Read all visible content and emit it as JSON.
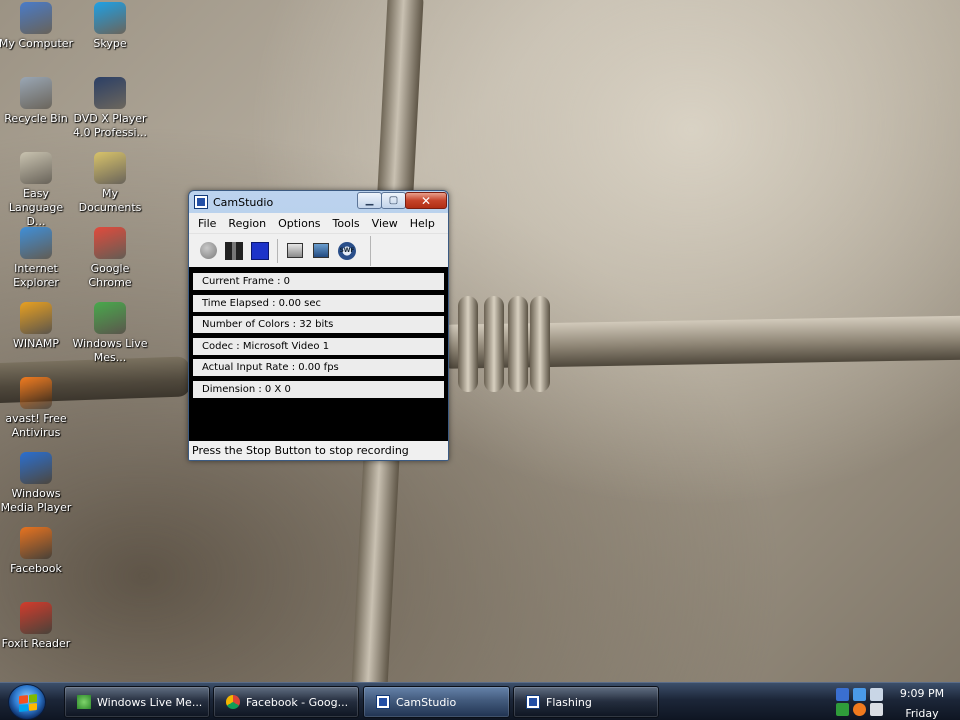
{
  "desktop": {
    "icons": [
      {
        "label": "My Computer",
        "icon": "computer-icon",
        "color": "#4a7cc9"
      },
      {
        "label": "Skype",
        "icon": "skype-icon",
        "color": "#1ea1e6"
      },
      {
        "label": "Recycle Bin",
        "icon": "recycle-bin-icon",
        "color": "#9aa7b5"
      },
      {
        "label": "DVD X Player 4.0 Professi...",
        "icon": "dvd-player-icon",
        "color": "#2b3f66"
      },
      {
        "label": "Easy Language D...",
        "icon": "book-icon",
        "color": "#c9c3b0"
      },
      {
        "label": "My Documents",
        "icon": "folder-icon",
        "color": "#d8c36a"
      },
      {
        "label": "Internet Explorer",
        "icon": "internet-explorer-icon",
        "color": "#3f8fd8"
      },
      {
        "label": "Google Chrome",
        "icon": "chrome-icon",
        "color": "#e24a3c"
      },
      {
        "label": "WINAMP",
        "icon": "winamp-icon",
        "color": "#e8a020"
      },
      {
        "label": "Windows Live Mes...",
        "icon": "messenger-icon",
        "color": "#48a94c"
      },
      {
        "label": "avast! Free Antivirus",
        "icon": "avast-icon",
        "color": "#f07a1e"
      },
      {
        "label": "Windows Media Player",
        "icon": "media-player-icon",
        "color": "#2a6fd0"
      },
      {
        "label": "Facebook",
        "icon": "firefox-icon",
        "color": "#e8731f"
      },
      {
        "label": "Foxit Reader",
        "icon": "foxit-reader-icon",
        "color": "#d33b2c"
      }
    ]
  },
  "window": {
    "title": "CamStudio",
    "minimize_glyph": "▁",
    "maximize_glyph": "▢",
    "close_glyph": "✕",
    "menu": [
      "File",
      "Region",
      "Options",
      "Tools",
      "View",
      "Help"
    ],
    "toolbar": [
      "record-icon",
      "pause-icon",
      "stop-icon",
      "autopan-icon",
      "annotation-icon",
      "swf-icon"
    ],
    "swf_text": "SWF",
    "info": [
      "Current Frame : 0",
      "Time Elapsed : 0.00 sec",
      "Number of Colors : 32 bits",
      "Codec : Microsoft Video 1",
      "Actual Input Rate : 0.00 fps",
      "Dimension : 0 X 0"
    ],
    "status": "Press the Stop Button to stop recording"
  },
  "taskbar": {
    "buttons": [
      {
        "label": "Windows Live Me...",
        "icon": "messenger-icon",
        "active": false
      },
      {
        "label": "Facebook - Goog...",
        "icon": "chrome-icon",
        "active": false
      },
      {
        "label": "CamStudio",
        "icon": "camstudio-icon",
        "active": true
      },
      {
        "label": "Flashing",
        "icon": "camstudio-icon",
        "active": false
      }
    ],
    "clock_time": "9:09 PM",
    "clock_day": "Friday"
  },
  "colors": {
    "window_frame": "#a5c1e3",
    "close_button": "#c6432a",
    "stop_button": "#1d33c9",
    "taskbar": "#1c2638"
  }
}
